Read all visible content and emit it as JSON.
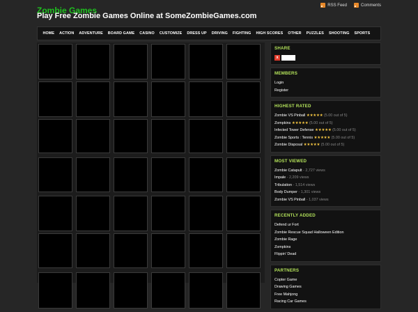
{
  "header": {
    "site_title": "Zombie Games",
    "tagline": "Play Free Zombie Games Online at SomeZombieGames.com",
    "rss_label": "RSS Feed",
    "comments_label": "Comments"
  },
  "nav": [
    "HOME",
    "ACTION",
    "ADVENTURE",
    "BOARD GAME",
    "CASINO",
    "CUSTOMIZE",
    "DRESS UP",
    "DRIVING",
    "FIGHTING",
    "HIGH SCORES",
    "OTHER",
    "PUZZLES",
    "SHOOTING",
    "SPORTS"
  ],
  "sidebar": {
    "share": {
      "title": "SHARE",
      "icon": "share-x-icon"
    },
    "members": {
      "title": "MEMBERS",
      "items": [
        "Login",
        "Register"
      ]
    },
    "highest_rated": {
      "title": "HIGHEST RATED",
      "rating_text": "(5.00 out of 5)",
      "stars": "★★★★★",
      "items": [
        "Zombie VS Pinball",
        "Zompkins",
        "Infected Tower Defense",
        "Zombie Sports : Tennis",
        "Zombie Disposal"
      ]
    },
    "most_viewed": {
      "title": "MOST VIEWED",
      "items": [
        {
          "name": "Zombie Catapult",
          "views": "2,727 views"
        },
        {
          "name": "Impale",
          "views": "2,209 views"
        },
        {
          "name": "Tribulation",
          "views": "1,514 views"
        },
        {
          "name": "Body Dumper",
          "views": "1,301 views"
        },
        {
          "name": "Zombie VS Pinball",
          "views": "1,037 views"
        }
      ]
    },
    "recently_added": {
      "title": "RECENTLY ADDED",
      "items": [
        "Defend ur Fort",
        "Zombie Rescue Squad Halloween Edition",
        "Zombie Rage",
        "Zompkins",
        "Flippin' Dead"
      ]
    },
    "partners": {
      "title": "PARTNERS",
      "items": [
        "Copter Game",
        "Drawing Games",
        "Free Mahjong",
        "Racing Car Games"
      ]
    }
  },
  "colors": {
    "site_title": "#1fbf1f",
    "widget_title": "#b3e25a",
    "stars": "#f4c542",
    "background": "#262626"
  }
}
